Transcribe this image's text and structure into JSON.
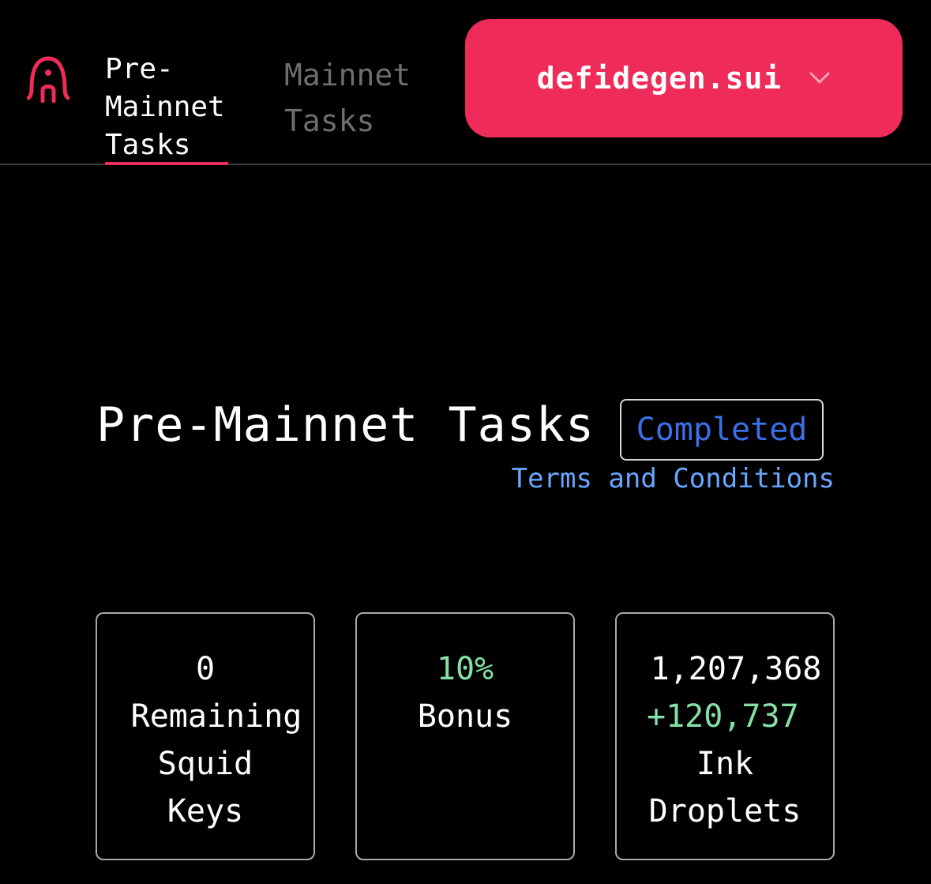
{
  "header": {
    "tabs": [
      {
        "label": "Pre-Mainnet Tasks",
        "active": true
      },
      {
        "label": "Mainnet Tasks",
        "active": false
      }
    ],
    "wallet": {
      "label": "defidegen.sui"
    },
    "accent_color": "#ef2b5a"
  },
  "main": {
    "title": "Pre-Mainnet Tasks",
    "status_badge": "Completed",
    "terms_link": "Terms and Conditions"
  },
  "stats": {
    "remaining_keys": {
      "value": "0",
      "label_lines": [
        "Remaining",
        "Squid",
        "Keys"
      ]
    },
    "bonus": {
      "value": "10%",
      "label": "Bonus"
    },
    "ink": {
      "value": "1,207,368",
      "delta": "+120,737",
      "label_lines": [
        "Ink",
        "Droplets"
      ]
    }
  }
}
